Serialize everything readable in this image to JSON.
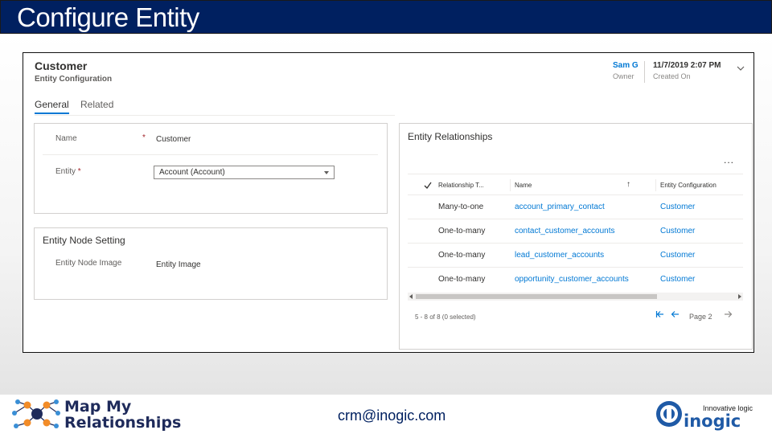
{
  "slide": {
    "title": "Configure Entity",
    "contact_email": "crm@inogic.com",
    "brand_color": "#002060"
  },
  "form": {
    "title": "Customer",
    "subtitle": "Entity Configuration",
    "header": {
      "owner_value": "Sam G",
      "owner_label": "Owner",
      "created_value": "11/7/2019 2:07 PM",
      "created_label": "Created On"
    },
    "tabs": [
      {
        "label": "General",
        "active": true
      },
      {
        "label": "Related",
        "active": false
      }
    ],
    "general": {
      "name_label": "Name",
      "name_required": "*",
      "name_value": "Customer",
      "entity_label": "Entity",
      "entity_required": "*",
      "entity_value": "Account (Account)"
    },
    "node_setting": {
      "title": "Entity Node Setting",
      "image_label": "Entity Node Image",
      "image_value": "Entity Image"
    },
    "relationships": {
      "title": "Entity Relationships",
      "more": "...",
      "columns": [
        "Relationship T...",
        "Name",
        "Entity Configuration"
      ],
      "sort_indicator": "↑",
      "rows": [
        {
          "type": "Many-to-one",
          "name": "account_primary_contact",
          "config": "Customer"
        },
        {
          "type": "One-to-many",
          "name": "contact_customer_accounts",
          "config": "Customer"
        },
        {
          "type": "One-to-many",
          "name": "lead_customer_accounts",
          "config": "Customer"
        },
        {
          "type": "One-to-many",
          "name": "opportunity_customer_accounts",
          "config": "Customer"
        }
      ],
      "footer_count": "5 - 8 of 8 (0 selected)",
      "page_label": "Page 2"
    }
  },
  "logos": {
    "mmr_line1": "Map My",
    "mmr_line2": "Relationships",
    "inogic_tagline": "Innovative logic",
    "inogic_word": "inogic"
  }
}
